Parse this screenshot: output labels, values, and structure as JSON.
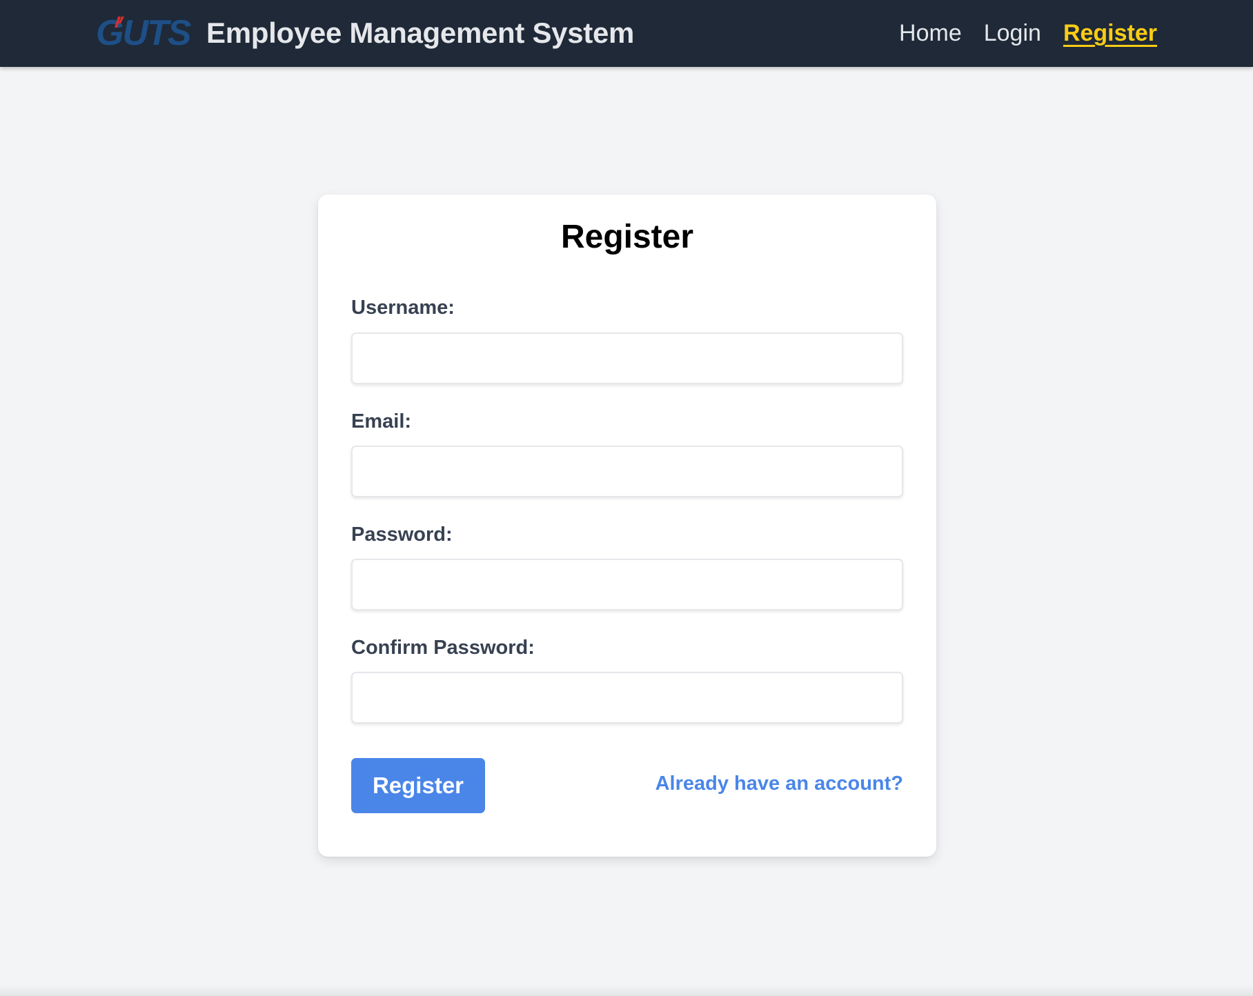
{
  "header": {
    "logo_text": "GUTS",
    "title": "Employee Management System",
    "nav": [
      {
        "label": "Home"
      },
      {
        "label": "Login"
      },
      {
        "label": "Register"
      }
    ]
  },
  "form": {
    "title": "Register",
    "fields": [
      {
        "label": "Username:",
        "value": ""
      },
      {
        "label": "Email:",
        "value": ""
      },
      {
        "label": "Password:",
        "value": ""
      },
      {
        "label": "Confirm Password:",
        "value": ""
      }
    ],
    "submit_label": "Register",
    "login_link": "Already have an account?"
  },
  "colors": {
    "navbar_bg": "#1f2937",
    "accent_blue": "#4a86e8",
    "active_nav": "#facc15",
    "logo_blue": "#1e4f86",
    "logo_red": "#d32f2f"
  }
}
